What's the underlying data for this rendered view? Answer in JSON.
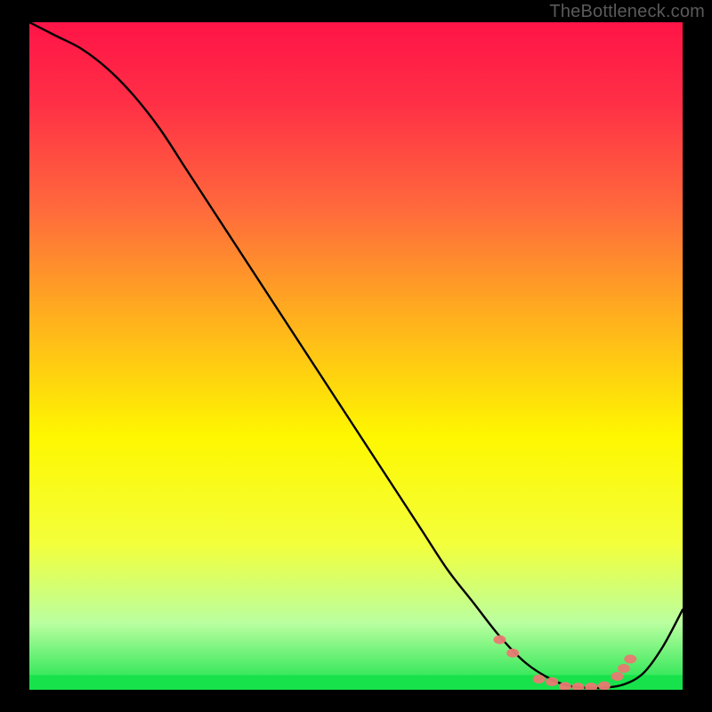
{
  "attribution": "TheBottleneck.com",
  "colors": {
    "curve": "#000000",
    "markers": "#e97a72",
    "green_band": "#17e24b",
    "frame_bg": "#000000"
  },
  "chart_data": {
    "type": "line",
    "title": "",
    "xlabel": "",
    "ylabel": "",
    "xlim": [
      0,
      100
    ],
    "ylim": [
      0,
      100
    ],
    "grid": false,
    "legend": false,
    "curve": {
      "x": [
        0,
        4,
        8,
        12,
        16,
        20,
        24,
        28,
        32,
        36,
        40,
        44,
        48,
        52,
        56,
        60,
        64,
        68,
        72,
        76,
        80,
        83,
        86,
        88,
        91,
        94,
        97,
        100
      ],
      "y": [
        100,
        98,
        96,
        93,
        89,
        84,
        78,
        72,
        66,
        60,
        54,
        48,
        42,
        36,
        30,
        24,
        18,
        13,
        8,
        4,
        1.5,
        0.5,
        0.3,
        0.3,
        0.8,
        2.5,
        6.5,
        12
      ]
    },
    "markers": {
      "x": [
        72,
        74,
        78,
        80,
        82,
        84,
        86,
        88,
        90,
        91,
        92
      ],
      "y": [
        7.5,
        5.5,
        1.6,
        1.2,
        0.5,
        0.4,
        0.4,
        0.6,
        2.0,
        3.2,
        4.6
      ]
    },
    "green_band": {
      "y0": 0,
      "y1": 2.2
    },
    "gradient_stops": [
      {
        "offset": 0.0,
        "color": "#ff1447"
      },
      {
        "offset": 0.12,
        "color": "#ff2f46"
      },
      {
        "offset": 0.28,
        "color": "#ff6a3c"
      },
      {
        "offset": 0.45,
        "color": "#ffb31c"
      },
      {
        "offset": 0.62,
        "color": "#fef700"
      },
      {
        "offset": 0.78,
        "color": "#f3ff3a"
      },
      {
        "offset": 0.9,
        "color": "#baffa0"
      },
      {
        "offset": 1.0,
        "color": "#17e24b"
      }
    ]
  }
}
